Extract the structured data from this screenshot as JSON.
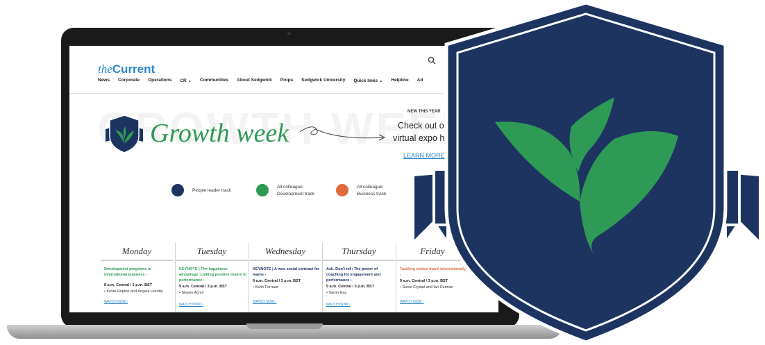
{
  "site": {
    "logo_the": "the",
    "logo_current": "Current"
  },
  "nav": {
    "items": [
      "News",
      "Corporate",
      "Operations",
      "CR ⌄",
      "Communities",
      "About Sedgwick",
      "Props",
      "Sedgwick University",
      "Quick links ⌄",
      "Helpline",
      "Ad"
    ]
  },
  "header_icons": {
    "search": "search-icon",
    "text": "⌕    🔔"
  },
  "hero": {
    "watermark": "GROWTH WEEK",
    "title": "Growth week"
  },
  "promo": {
    "eyebrow": "NEW THIS YEAR",
    "line1": "Check out ou",
    "line2": "virtual expo ha",
    "link": "LEARN MORE ›"
  },
  "legend": [
    {
      "label": "People leader track",
      "color": "#1d3461"
    },
    {
      "label": "All colleague: Development track",
      "color": "#2e9a55"
    },
    {
      "label": "All colleague: Business track",
      "color": "#e06a3a"
    }
  ],
  "schedule": [
    {
      "day": "Monday",
      "title": "Development programs in international business ›",
      "title_color": "#2e9a55",
      "time": "8 a.m. Central / 2 p.m. BST",
      "speaker": "• Kevin Hopton and Angela Hornby",
      "watch": "WATCH NOW ›"
    },
    {
      "day": "Tuesday",
      "title": "KEYNOTE | The happiness advantage: Linking positive brains to performance ›",
      "title_color": "#2e9a55",
      "time": "9 a.m. Central / 3 p.m. BST",
      "speaker": "• Shawn Achor",
      "watch": "WATCH NOW ›"
    },
    {
      "day": "Wednesday",
      "title": "KEYNOTE | A new social contract for teams ›",
      "title_color": "#1d3461",
      "time": "9 a.m. Central / 3 p.m. BST",
      "speaker": "• Keith Ferrazzi",
      "watch": "WATCH NOW ›"
    },
    {
      "day": "Thursday",
      "title": "Ask. Don't tell: The power of coaching for engagement and performance ›",
      "title_color": "#1d3461",
      "time": "9 a.m. Central / 3 p.m. BST",
      "speaker": "• Sarah Kay",
      "watch": "WATCH NOW ›"
    },
    {
      "day": "Friday",
      "title": "Tackling claims fraud internationally ›",
      "title_color": "#e06a3a",
      "time": "9 a.m. Central / 3 p.m. BST",
      "speaker": "• Steve Crystal and Ian Carman",
      "watch": "WATCH NOW ›"
    }
  ],
  "colors": {
    "navy": "#1d3461",
    "green": "#2e9a55",
    "orange": "#e06a3a",
    "link": "#2a85c6"
  }
}
